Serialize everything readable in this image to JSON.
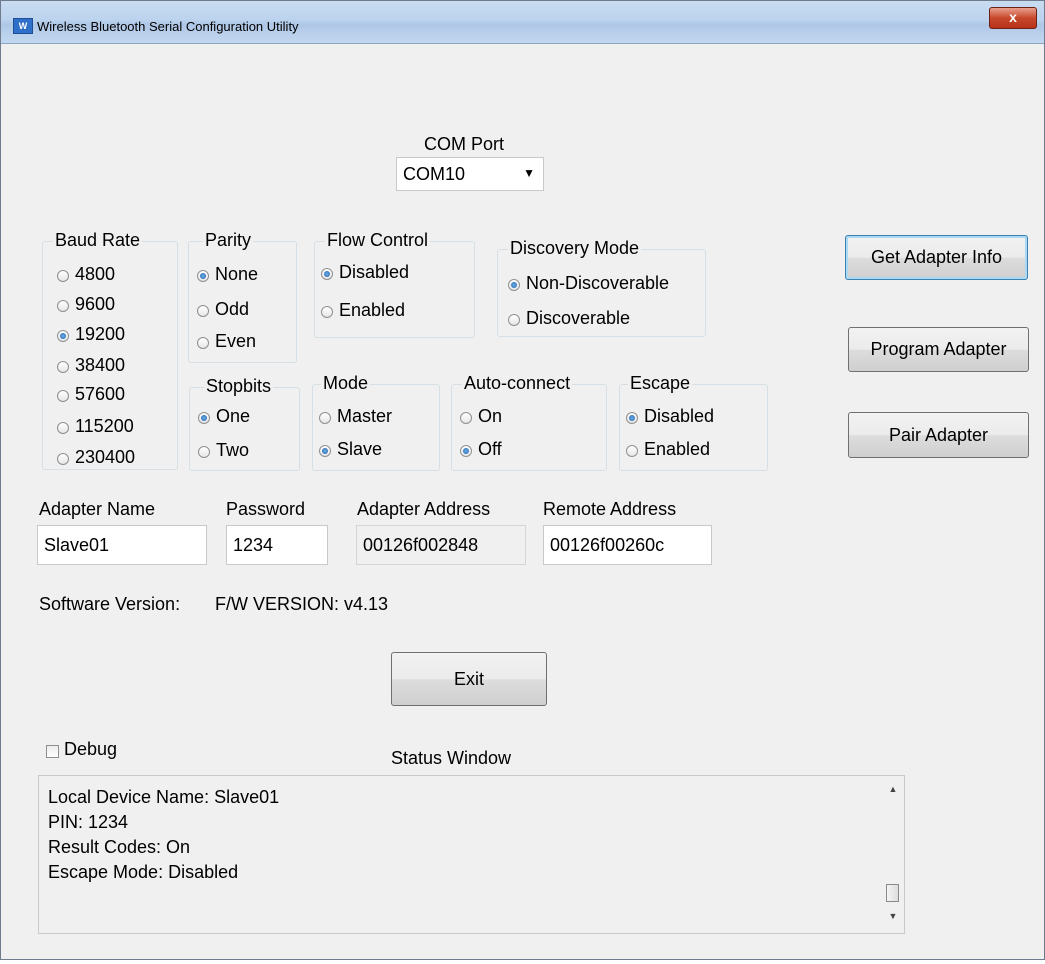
{
  "window": {
    "title": "Wireless Bluetooth Serial Configuration Utility",
    "close_glyph": "x"
  },
  "com_port": {
    "label": "COM Port",
    "value": "COM10"
  },
  "baud_rate": {
    "label": "Baud Rate",
    "options": [
      "4800",
      "9600",
      "19200",
      "38400",
      "57600",
      "115200",
      "230400"
    ],
    "selected": "19200"
  },
  "parity": {
    "label": "Parity",
    "options": [
      "None",
      "Odd",
      "Even"
    ],
    "selected": "None"
  },
  "flow_control": {
    "label": "Flow Control",
    "options": [
      "Disabled",
      "Enabled"
    ],
    "selected": "Disabled"
  },
  "discovery_mode": {
    "label": "Discovery Mode",
    "options": [
      "Non-Discoverable",
      "Discoverable"
    ],
    "selected": "Non-Discoverable"
  },
  "stopbits": {
    "label": "Stopbits",
    "options": [
      "One",
      "Two"
    ],
    "selected": "One"
  },
  "mode": {
    "label": "Mode",
    "options": [
      "Master",
      "Slave"
    ],
    "selected": "Slave"
  },
  "auto_connect": {
    "label": "Auto-connect",
    "options": [
      "On",
      "Off"
    ],
    "selected": "Off"
  },
  "escape": {
    "label": "Escape",
    "options": [
      "Disabled",
      "Enabled"
    ],
    "selected": "Disabled"
  },
  "buttons": {
    "get_info": "Get Adapter Info",
    "program": "Program Adapter",
    "pair": "Pair Adapter",
    "exit": "Exit"
  },
  "fields": {
    "adapter_name": {
      "label": "Adapter Name",
      "value": "Slave01"
    },
    "password": {
      "label": "Password",
      "value": "1234"
    },
    "adapter_address": {
      "label": "Adapter Address",
      "value": "00126f002848"
    },
    "remote_address": {
      "label": "Remote Address",
      "value": "00126f00260c"
    }
  },
  "software_version": {
    "label": "Software Version:",
    "value": "F/W VERSION: v4.13"
  },
  "debug": {
    "label": "Debug",
    "checked": false
  },
  "status_window": {
    "label": "Status Window",
    "lines": [
      "Local Device Name: Slave01",
      "PIN: 1234",
      "Result Codes: On",
      "Escape Mode: Disabled"
    ]
  }
}
